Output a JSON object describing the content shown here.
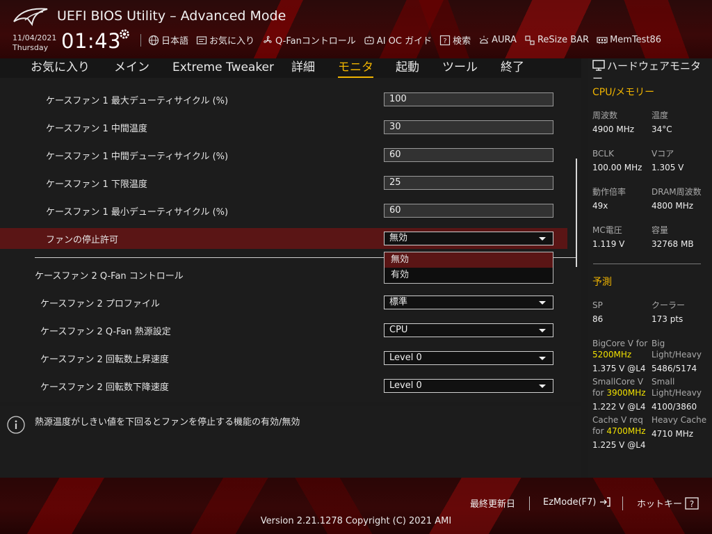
{
  "header": {
    "title": "UEFI BIOS Utility – Advanced Mode",
    "date": "11/04/2021",
    "weekday": "Thursday",
    "time": "01:43",
    "toolbar": [
      {
        "icon": "globe-icon",
        "label": "日本語"
      },
      {
        "icon": "favorites-icon",
        "label": "お気に入り"
      },
      {
        "icon": "fan-icon",
        "label": "Q-Fanコントロール"
      },
      {
        "icon": "ai-oc-icon",
        "label": "AI OC ガイド"
      },
      {
        "icon": "question-icon",
        "label": "検索"
      },
      {
        "icon": "aura-icon",
        "label": "AURA"
      },
      {
        "icon": "resize-bar-icon",
        "label": "ReSize BAR"
      },
      {
        "icon": "memtest-icon",
        "label": "MemTest86"
      }
    ]
  },
  "menu": {
    "items": [
      "お気に入り",
      "メイン",
      "Extreme Tweaker",
      "詳細",
      "モニタ",
      "起動",
      "ツール",
      "終了"
    ],
    "active": "モニタ"
  },
  "settings": {
    "rows": [
      {
        "label": "ケースファン 1 最大デューティサイクル (%)",
        "value": "100",
        "kind": "input"
      },
      {
        "label": "ケースファン 1 中間温度",
        "value": "30",
        "kind": "input"
      },
      {
        "label": "ケースファン 1 中間デューティサイクル (%)",
        "value": "60",
        "kind": "input"
      },
      {
        "label": "ケースファン 1 下限温度",
        "value": "25",
        "kind": "input"
      },
      {
        "label": "ケースファン 1 最小デューティサイクル (%)",
        "value": "60",
        "kind": "input"
      },
      {
        "label": "ファンの停止許可",
        "value": "無効",
        "kind": "select"
      }
    ],
    "group_title": "ケースファン 2 Q-Fan コントロール",
    "rows2": [
      {
        "label": "ケースファン 2 プロファイル",
        "value": "標準"
      },
      {
        "label": "ケースファン 2 Q-Fan 熱源設定",
        "value": "CPU"
      },
      {
        "label": "ケースファン 2 回転数上昇速度",
        "value": "Level 0"
      },
      {
        "label": "ケースファン 2 回転数下降速度",
        "value": "Level 0"
      }
    ],
    "dropdown_options": [
      "無効",
      "有効"
    ],
    "dropdown_selected": "無効"
  },
  "info": {
    "text": "熱源温度がしきい値を下回るとファンを停止する機能の有効/無効"
  },
  "hw_monitor": {
    "title": "ハードウェアモニター",
    "cpu_section": "CPU/メモリー",
    "cpu": [
      {
        "k1": "周波数",
        "v1": "4900 MHz",
        "k2": "温度",
        "v2": "34°C"
      },
      {
        "k1": "BCLK",
        "v1": "100.00 MHz",
        "k2": "Vコア",
        "v2": "1.305 V"
      },
      {
        "k1": "動作倍率",
        "v1": "49x",
        "k2": "DRAM周波数",
        "v2": "4800 MHz"
      },
      {
        "k1": "MC電圧",
        "v1": "1.119 V",
        "k2": "容量",
        "v2": "32768 MB"
      }
    ],
    "predict_section": "予測",
    "sp_label": "SP",
    "sp_value": "86",
    "cooler_label": "クーラー",
    "cooler_value": "173 pts",
    "bigcore_label": "BigCore V for",
    "bigcore_freq": "5200MHz",
    "bigcore_value": "1.375 V @L4",
    "big_label1": "Big",
    "big_label2": "Light/Heavy",
    "big_value": "5486/5174",
    "smallcore_label": "SmallCore V",
    "smallcore_for": "for",
    "smallcore_freq": "3900MHz",
    "smallcore_value": "1.222 V @L4",
    "small_label1": "Small",
    "small_label2": "Light/Heavy",
    "small_value": "4100/3860",
    "cache_label": "Cache V req",
    "cache_for": "for",
    "cache_freq": "4700MHz",
    "cache_value": "1.225 V @L4",
    "heavycache_label": "Heavy Cache",
    "heavycache_value": "4710 MHz"
  },
  "footer": {
    "last_modified": "最終更新日",
    "ezmode": "EzMode(F7)",
    "hotkeys": "ホットキー",
    "version": "Version 2.21.1278 Copyright (C) 2021 AMI"
  },
  "colors": {
    "accent": "#f0b400",
    "highlight": "#5a1515",
    "predict_freq": "#f0e000"
  }
}
